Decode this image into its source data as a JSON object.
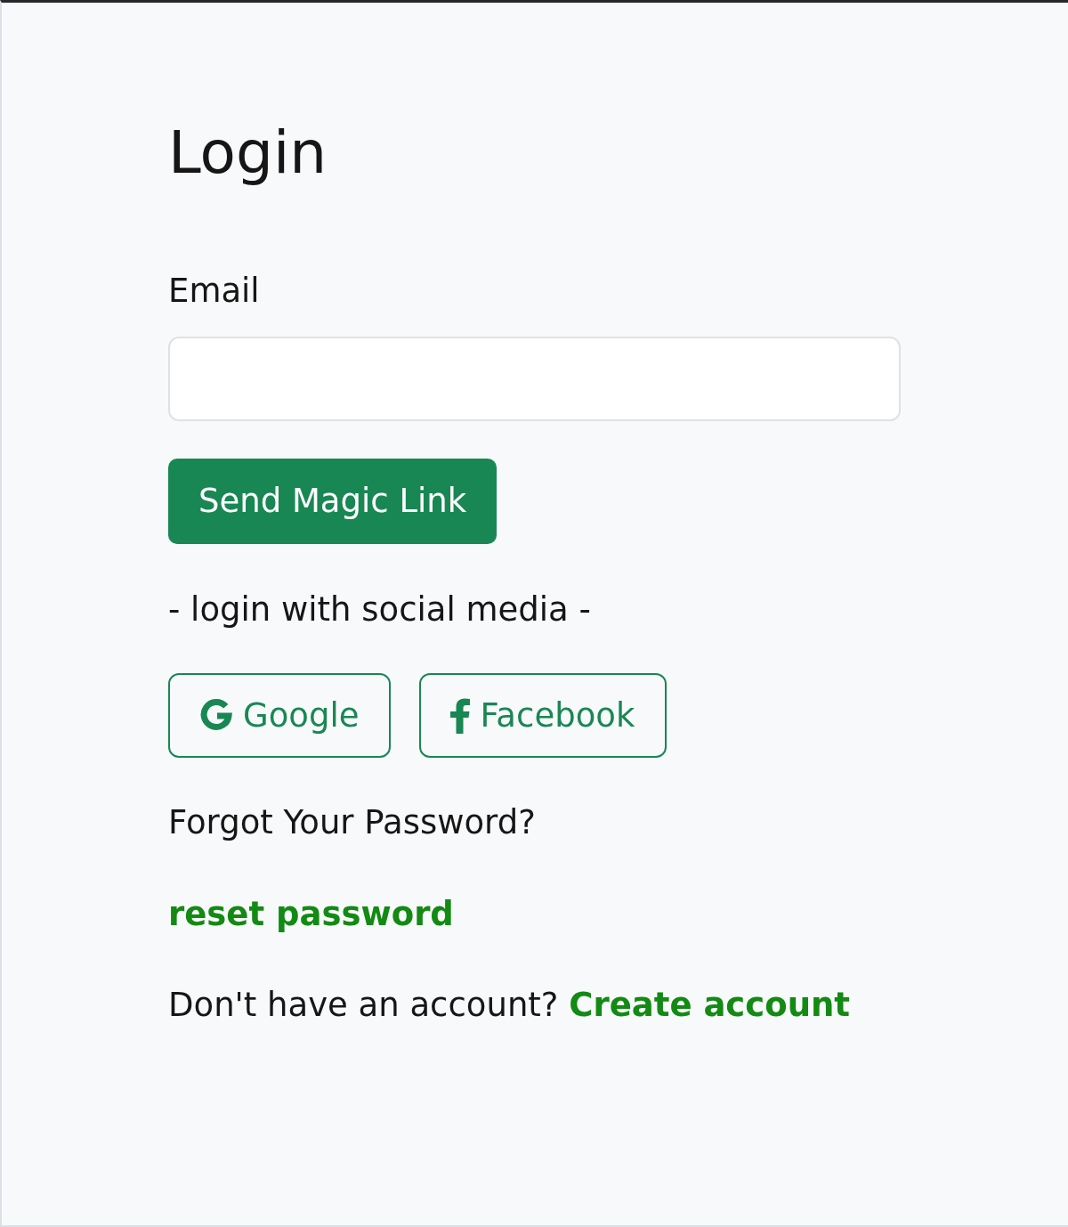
{
  "title": "Login",
  "email_field": {
    "label": "Email"
  },
  "submit_button": "Send Magic Link",
  "social_divider": "- login with social media -",
  "social_buttons": [
    {
      "kind": "google",
      "label": "Google"
    },
    {
      "kind": "facebook",
      "label": "Facebook"
    }
  ],
  "forgot_text": "Forgot Your Password?",
  "reset_link": "reset password",
  "signup": {
    "text": "Don't have an account?",
    "link": "Create account"
  }
}
